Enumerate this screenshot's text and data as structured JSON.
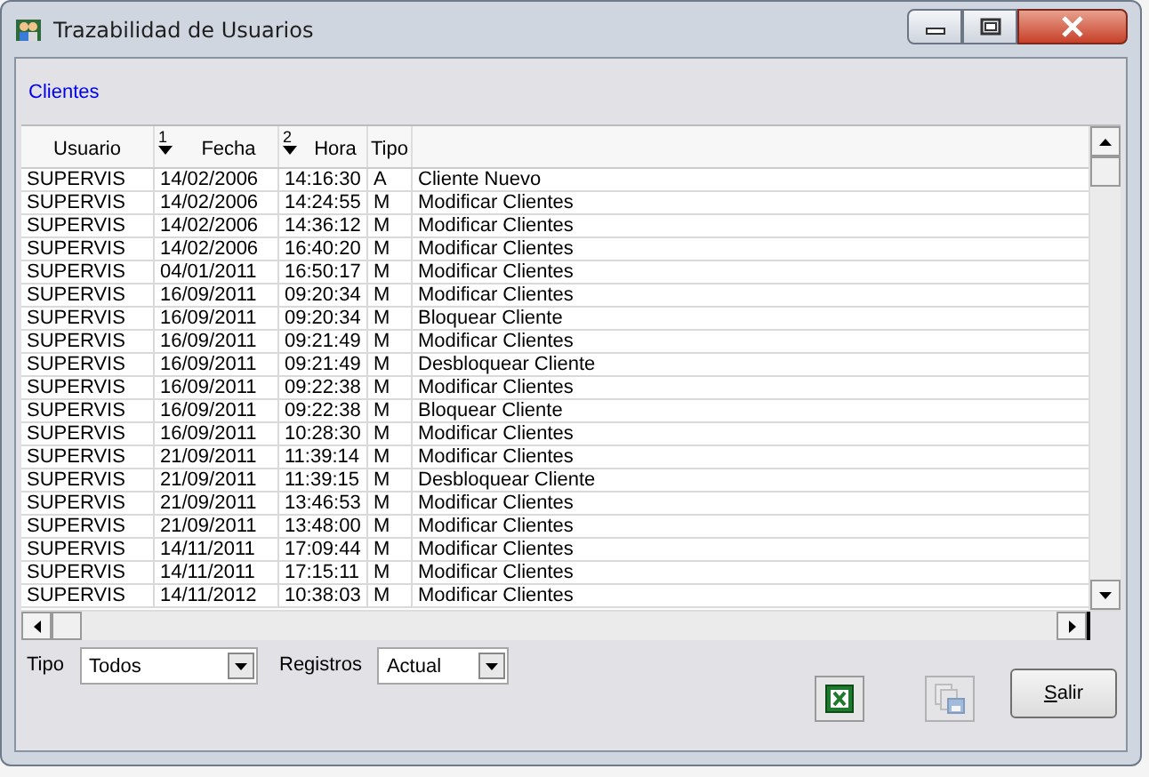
{
  "window": {
    "title": "Trazabilidad de Usuarios"
  },
  "section_title": "Clientes",
  "table": {
    "columns": [
      {
        "label": "Usuario"
      },
      {
        "label": "Fecha",
        "sort_order": "1",
        "descending": true
      },
      {
        "label": "Hora",
        "sort_order": "2",
        "descending": true
      },
      {
        "label": "Tipo"
      }
    ],
    "rows": [
      [
        "SUPERVIS",
        "14/02/2006",
        "14:16:30",
        "A",
        "Cliente Nuevo"
      ],
      [
        "SUPERVIS",
        "14/02/2006",
        "14:24:55",
        "M",
        "Modificar Clientes"
      ],
      [
        "SUPERVIS",
        "14/02/2006",
        "14:36:12",
        "M",
        "Modificar Clientes"
      ],
      [
        "SUPERVIS",
        "14/02/2006",
        "16:40:20",
        "M",
        "Modificar Clientes"
      ],
      [
        "SUPERVIS",
        "04/01/2011",
        "16:50:17",
        "M",
        "Modificar Clientes"
      ],
      [
        "SUPERVIS",
        "16/09/2011",
        "09:20:34",
        "M",
        "Modificar Clientes"
      ],
      [
        "SUPERVIS",
        "16/09/2011",
        "09:20:34",
        "M",
        "Bloquear Cliente"
      ],
      [
        "SUPERVIS",
        "16/09/2011",
        "09:21:49",
        "M",
        "Modificar Clientes"
      ],
      [
        "SUPERVIS",
        "16/09/2011",
        "09:21:49",
        "M",
        "Desbloquear Cliente"
      ],
      [
        "SUPERVIS",
        "16/09/2011",
        "09:22:38",
        "M",
        "Modificar Clientes"
      ],
      [
        "SUPERVIS",
        "16/09/2011",
        "09:22:38",
        "M",
        "Bloquear Cliente"
      ],
      [
        "SUPERVIS",
        "16/09/2011",
        "10:28:30",
        "M",
        "Modificar Clientes"
      ],
      [
        "SUPERVIS",
        "21/09/2011",
        "11:39:14",
        "M",
        "Modificar Clientes"
      ],
      [
        "SUPERVIS",
        "21/09/2011",
        "11:39:15",
        "M",
        "Desbloquear Cliente"
      ],
      [
        "SUPERVIS",
        "21/09/2011",
        "13:46:53",
        "M",
        "Modificar Clientes"
      ],
      [
        "SUPERVIS",
        "21/09/2011",
        "13:48:00",
        "M",
        "Modificar Clientes"
      ],
      [
        "SUPERVIS",
        "14/11/2011",
        "17:09:44",
        "M",
        "Modificar Clientes"
      ],
      [
        "SUPERVIS",
        "14/11/2011",
        "17:15:11",
        "M",
        "Modificar Clientes"
      ],
      [
        "SUPERVIS",
        "14/11/2012",
        "10:38:03",
        "M",
        "Modificar Clientes"
      ]
    ]
  },
  "filters": [
    {
      "label": "Tipo",
      "value": "Todos"
    },
    {
      "label": "Registros",
      "value": "Actual"
    }
  ],
  "buttons": [
    {
      "kind": "excel",
      "disabled": false
    },
    {
      "kind": "save",
      "disabled": true
    },
    {
      "kind": "text",
      "label": "Salir",
      "disabled": false
    }
  ]
}
